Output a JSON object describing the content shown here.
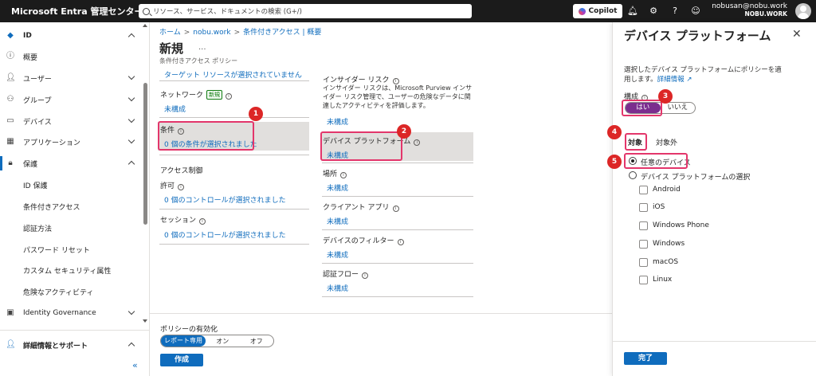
{
  "topbar": {
    "brand": "Microsoft Entra 管理センター",
    "search_placeholder": "リソース、サービス、ドキュメントの検索 (G+/)",
    "copilot_label": "Copilot",
    "user_name": "nobusan@nobu.work",
    "user_tenant": "NOBU.WORK",
    "icons": [
      "bell-icon",
      "gear-icon",
      "help-icon",
      "feedback-icon"
    ]
  },
  "sidebar": {
    "items": [
      {
        "label": "ID",
        "icon": "id-diamond-icon",
        "chevron": "up"
      },
      {
        "label": "概要",
        "icon": "info-icon"
      },
      {
        "label": "ユーザー",
        "icon": "user-icon",
        "chevron": "down"
      },
      {
        "label": "グループ",
        "icon": "group-icon",
        "chevron": "down"
      },
      {
        "label": "デバイス",
        "icon": "devices-icon",
        "chevron": "down"
      },
      {
        "label": "アプリケーション",
        "icon": "apps-icon",
        "chevron": "down"
      },
      {
        "label": "保護",
        "icon": "lock-icon",
        "chevron": "up"
      }
    ],
    "sub_items": [
      "ID 保護",
      "条件付きアクセス",
      "認証方法",
      "パスワード リセット",
      "カスタム セキュリティ属性",
      "危険なアクティビティ"
    ],
    "identity_governance": {
      "label": "Identity Governance",
      "icon": "governance-icon",
      "chevron": "down"
    },
    "learn_support": {
      "label": "詳細情報とサポート",
      "icon": "person-help-icon",
      "chevron": "up"
    },
    "collapse_glyph": "«"
  },
  "main": {
    "breadcrumb": [
      "ホーム",
      "nobu.work",
      "条件付きアクセス | 概要"
    ],
    "title": "新規",
    "more_glyph": "...",
    "subtitle": "条件付きアクセス ポリシー",
    "left": {
      "target_resources_link": "ターゲット リソースが選択されていません",
      "network_label": "ネットワーク",
      "network_badge": "新規",
      "network_value": "未構成",
      "conditions_label": "条件",
      "conditions_value": "0 個の条件が選択されました",
      "access_controls_heading": "アクセス制御",
      "grant_label": "許可",
      "grant_value": "0 個のコントロールが選択されました",
      "session_label": "セッション",
      "session_value": "0 個のコントロールが選択されました"
    },
    "right": {
      "insider_risk_label": "インサイダー リスク",
      "insider_risk_desc": "インサイダー リスクは、Microsoft Purview インサイダー リスク管理で、ユーザーの危険なデータに関連したアクティビティを評価します。",
      "insider_risk_value": "未構成",
      "device_platform_label": "デバイス プラットフォーム",
      "device_platform_value": "未構成",
      "location_label": "場所",
      "location_value": "未構成",
      "client_apps_label": "クライアント アプリ",
      "client_apps_value": "未構成",
      "device_filter_label": "デバイスのフィルター",
      "device_filter_value": "未構成",
      "auth_flow_label": "認証フロー",
      "auth_flow_value": "未構成"
    },
    "footer": {
      "enable_label": "ポリシーの有効化",
      "options": [
        "レポート専用",
        "オン",
        "オフ"
      ],
      "selected": "レポート専用",
      "create_button": "作成"
    }
  },
  "panel": {
    "title": "デバイス プラットフォーム",
    "close_glyph": "✕",
    "description": "選択したデバイス プラットフォームにポリシーを適用します。",
    "learn_more": "詳細情報",
    "configure_label": "構成",
    "configure_options": [
      "はい",
      "いいえ"
    ],
    "configure_selected": "はい",
    "tabs": [
      "対象",
      "対象外"
    ],
    "active_tab": "対象",
    "radio_any": "任意のデバイス",
    "radio_select": "デバイス プラットフォームの選択",
    "platforms": [
      "Android",
      "iOS",
      "Windows Phone",
      "Windows",
      "macOS",
      "Linux"
    ],
    "done_button": "完了"
  },
  "markers": [
    "1",
    "2",
    "3",
    "4",
    "5"
  ],
  "colors": {
    "accent": "#0f6cbd",
    "highlight_box": "#e3366b",
    "marker": "#dc2626",
    "toggle_on": "#7b2d8e"
  }
}
